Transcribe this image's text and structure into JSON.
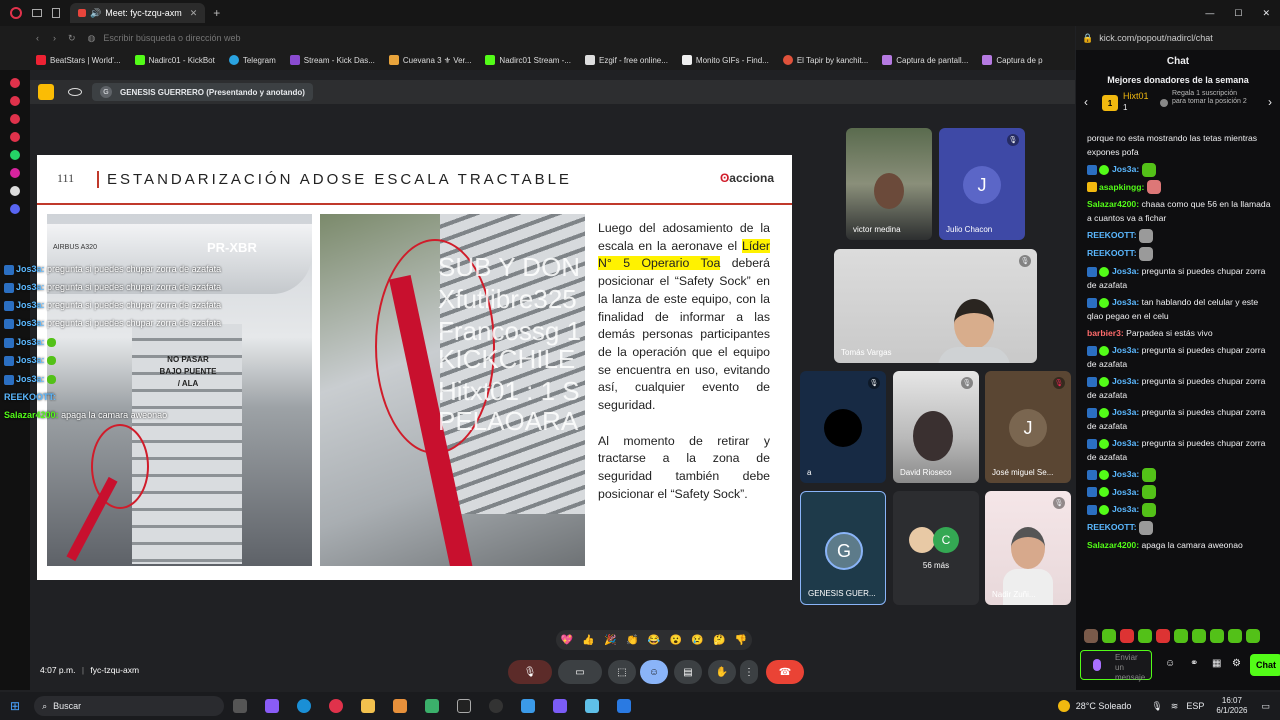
{
  "browser": {
    "tab_title": "Meet: fyc-tzqu-axm",
    "new_tab": "+",
    "address_placeholder": "Escribir búsqueda o dirección web",
    "bookmarks": [
      "BeatStars | World'...",
      "Nadirc01 - KickBot",
      "Telegram",
      "Stream - Kick Das...",
      "Cuevana 3 ⚜ Ver...",
      "Nadirc01 Stream -...",
      "Ezgif - free online...",
      "Monito GIFs - Find...",
      "El Tapir by kanchit...",
      "Captura de pantall...",
      "Captura de p"
    ]
  },
  "meet": {
    "presenter_label": "GENESIS GUERRERO (Presentando y anotando)",
    "presenter_initial": "G",
    "time": "4:07 p.m.",
    "meeting_code": "fyc-tzqu-axm",
    "reactions": [
      "💖",
      "👍",
      "🎉",
      "👏",
      "😂",
      "😮",
      "😢",
      "🤔",
      "👎"
    ]
  },
  "slide": {
    "number": "111",
    "title": "ESTANDARIZACIÓN ADOSE ESCALA TRACTABLE",
    "logo": "acciona",
    "plane_reg": "PR-XBR",
    "plane_model": "AIRBUS A320",
    "stair_sign": "NO PASAR BAJO PUENTE / ALA",
    "para1_a": "Luego del adosamiento de la escala en la aeronave el",
    "para1_hl": "Líder N° 5 Operario Toa",
    "para1_b": "deberá posicionar el “Safety Sock” en la lanza de este equipo, con la finalidad de informar a las demás personas participantes de la operación que el equipo se encuentra en uso, evitando así, cualquier evento de seguridad.",
    "para2": "Al momento de retirar y tractarse a la zona de seguridad también debe posicionar el “Safety Sock”."
  },
  "overlay": {
    "lines": [
      "SUB Y DON",
      "Xfutlibre325",
      "Francossg 1",
      "KICKCHILE",
      "Hitxt01 : 1 S",
      "PELAOARA"
    ],
    "chat": [
      {
        "user": "Jos3a:",
        "text": "pregunta si puedes chupar zorra de azafata"
      },
      {
        "user": "Jos3a:",
        "text": "pregunta si puedes chupar zorra de azafata"
      },
      {
        "user": "Jos3a:",
        "text": "pregunta si puedes chupar zorra de azafata"
      },
      {
        "user": "Jos3a:",
        "text": "pregunta si puedes chupar zorra de azafata"
      },
      {
        "user": "Jos3a:",
        "text": ""
      },
      {
        "user": "Jos3a:",
        "text": ""
      },
      {
        "user": "Jos3a:",
        "text": ""
      },
      {
        "user": "REEKOOTT:",
        "text": ""
      },
      {
        "user": "Salazar4200:",
        "text": "apaga la camara aweonao"
      }
    ]
  },
  "participants": [
    {
      "name": "victor medina",
      "initial": ""
    },
    {
      "name": "Julio Chacon",
      "initial": "J"
    },
    {
      "name": "Tomás Vargas",
      "initial": ""
    },
    {
      "name": "a",
      "initial": ""
    },
    {
      "name": "David Rioseco",
      "initial": ""
    },
    {
      "name": "José miguel Se...",
      "initial": "J"
    },
    {
      "name": "GENESIS GUER...",
      "initial": "G"
    },
    {
      "name": "56 más",
      "initial": "C"
    },
    {
      "name": "Nadir Zuñi...",
      "initial": ""
    }
  ],
  "chat": {
    "url": "kick.com/popout/nadircl/chat",
    "header": "Chat",
    "donors_title": "Mejores donadores de la semana",
    "donor_name": "Hixt01",
    "donor_rank": "1",
    "donor_count": "1",
    "gift_text": "Regala 1 suscripción para tomar la posición 2",
    "messages": [
      {
        "user": "",
        "text": "porque no esta mostrando las tetas mientras expones pofa",
        "color": "#efeff1"
      },
      {
        "user": "Jos3a:",
        "text": "",
        "color": "#5bb8ff"
      },
      {
        "user": "asapkingg:",
        "text": "",
        "color": "#ffd35c"
      },
      {
        "user": "Salazar4200:",
        "text": "chaaa como que 56 en la llamada a cuantos va a fichar",
        "color": "#53fc18"
      },
      {
        "user": "REEKOOTT:",
        "text": "",
        "color": "#5bb8ff"
      },
      {
        "user": "REEKOOTT:",
        "text": "",
        "color": "#5bb8ff"
      },
      {
        "user": "Jos3a:",
        "text": "pregunta si puedes chupar zorra de azafata",
        "color": "#5bb8ff"
      },
      {
        "user": "Jos3a:",
        "text": "tan hablando del celular y este qlao pegao en el celu",
        "color": "#5bb8ff"
      },
      {
        "user": "barbier3:",
        "text": "Parpadea si estás vivo",
        "color": "#ff6b6b"
      },
      {
        "user": "Jos3a:",
        "text": "pregunta si puedes chupar zorra de azafata",
        "color": "#5bb8ff"
      },
      {
        "user": "Jos3a:",
        "text": "pregunta si puedes chupar zorra de azafata",
        "color": "#5bb8ff"
      },
      {
        "user": "Jos3a:",
        "text": "pregunta si puedes chupar zorra de azafata",
        "color": "#5bb8ff"
      },
      {
        "user": "Jos3a:",
        "text": "pregunta si puedes chupar zorra de azafata",
        "color": "#5bb8ff"
      },
      {
        "user": "Jos3a:",
        "text": "",
        "color": "#5bb8ff"
      },
      {
        "user": "Jos3a:",
        "text": "",
        "color": "#5bb8ff"
      },
      {
        "user": "Jos3a:",
        "text": "",
        "color": "#5bb8ff"
      },
      {
        "user": "REEKOOTT:",
        "text": "",
        "color": "#5bb8ff"
      },
      {
        "user": "Salazar4200:",
        "text": "apaga la camara aweonao",
        "color": "#53fc18"
      }
    ],
    "input_placeholder": "Enviar un mensaje",
    "send_label": "Chat"
  },
  "taskbar": {
    "search": "Buscar",
    "weather": "28°C Soleado",
    "lang": "ESP",
    "time": "16:07",
    "date": "6/1/2026"
  }
}
